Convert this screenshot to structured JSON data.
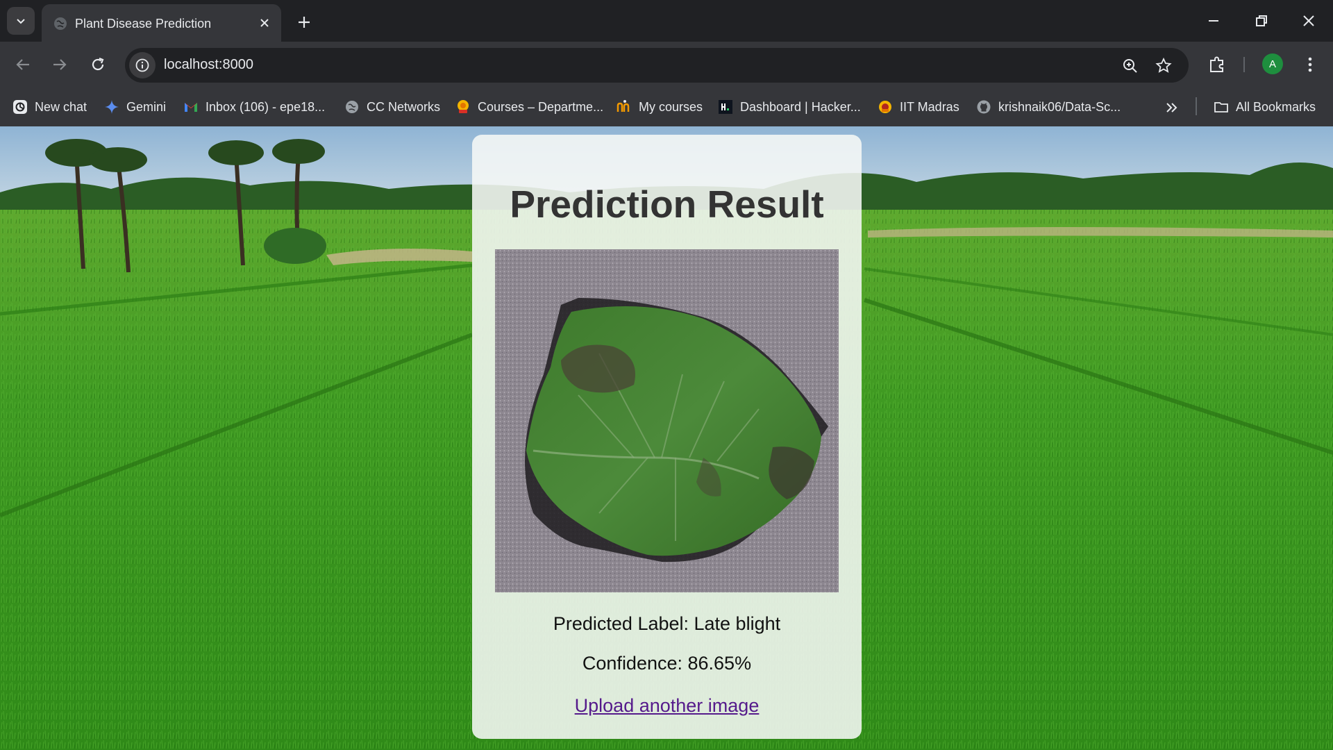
{
  "browser": {
    "tab": {
      "title": "Plant Disease Prediction"
    },
    "url": "localhost:8000",
    "profile_initial": "A",
    "bookmarks": [
      {
        "label": "New chat",
        "icon": "openai-icon"
      },
      {
        "label": "Gemini",
        "icon": "gemini-icon"
      },
      {
        "label": "Inbox (106) - epe18...",
        "icon": "gmail-icon"
      },
      {
        "label": "CC Networks",
        "icon": "globe-icon"
      },
      {
        "label": "Courses – Departme...",
        "icon": "course-site-icon"
      },
      {
        "label": "My courses",
        "icon": "my-courses-icon"
      },
      {
        "label": "Dashboard | Hacker...",
        "icon": "hackerrank-icon"
      },
      {
        "label": "IIT Madras",
        "icon": "iitm-icon"
      },
      {
        "label": "krishnaik06/Data-Sc...",
        "icon": "github-icon"
      }
    ],
    "all_bookmarks_label": "All Bookmarks"
  },
  "page": {
    "title": "Prediction Result",
    "predicted_label_text": "Predicted Label: Late blight",
    "confidence_text": "Confidence: 86.65%",
    "upload_link_text": "Upload another image"
  },
  "colors": {
    "tab_strip": "#202124",
    "toolbar": "#35363a",
    "link": "#551a8b",
    "avatar": "#1e8e3e"
  }
}
